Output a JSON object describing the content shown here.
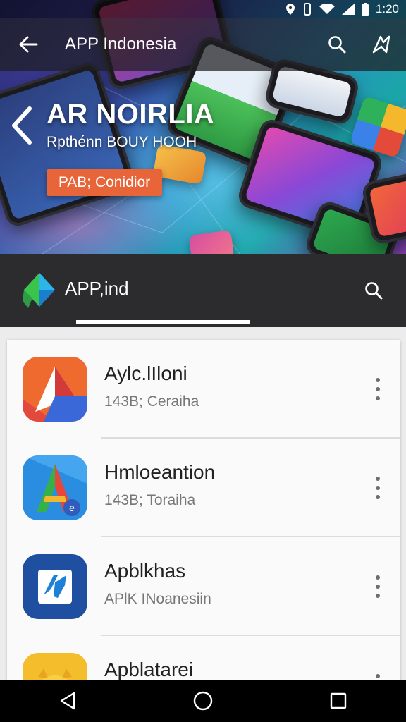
{
  "status_bar": {
    "time": "1:20",
    "icons": [
      "location-icon",
      "vibrate-icon",
      "wifi-icon",
      "signal-icon",
      "battery-icon"
    ]
  },
  "app_bar": {
    "title": "APP Indonesia",
    "back_icon": "arrow-back-icon",
    "search_icon": "search-icon",
    "extra_icon": "app-logo-icon"
  },
  "hero": {
    "title": "AR NOIRLIA",
    "subtitle": "Rpthénn BOUY HOOH",
    "badge": "PAB; Conidior"
  },
  "toolbar": {
    "title": "APP,ind",
    "search_icon": "search-icon"
  },
  "apps": [
    {
      "name": "Aylc.lIloni",
      "meta": "143B; Ceraiha",
      "icon": "app-icon-orange"
    },
    {
      "name": "Hmloeantion",
      "meta": "143B; Toraiha",
      "icon": "app-icon-blue-green"
    },
    {
      "name": "Apblkhas",
      "meta": "APlK INoanesiin",
      "icon": "app-icon-navy"
    },
    {
      "name": "Apblatarei",
      "meta": "",
      "icon": "app-icon-yellow"
    }
  ],
  "nav_bar": {
    "back": "nav-back-icon",
    "home": "nav-home-icon",
    "recents": "nav-recents-icon"
  },
  "colors": {
    "accent": "#e8653a",
    "toolbar_bg": "#2c2c2e",
    "list_bg": "#fafafa"
  }
}
